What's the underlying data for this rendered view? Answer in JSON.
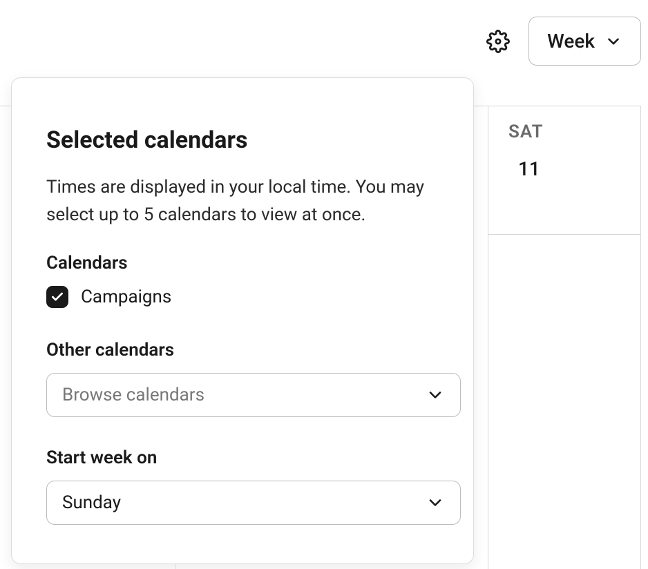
{
  "toolbar": {
    "view_label": "Week"
  },
  "calendar": {
    "sat": {
      "dow": "SAT",
      "dom": "11"
    }
  },
  "popover": {
    "title": "Selected calendars",
    "description": "Times are displayed in your local time. You may select up to 5 calendars to view at once.",
    "calendars_label": "Calendars",
    "calendar_item_1": "Campaigns",
    "other_label": "Other calendars",
    "other_placeholder": "Browse calendars",
    "start_week_label": "Start week on",
    "start_week_value": "Sunday"
  }
}
